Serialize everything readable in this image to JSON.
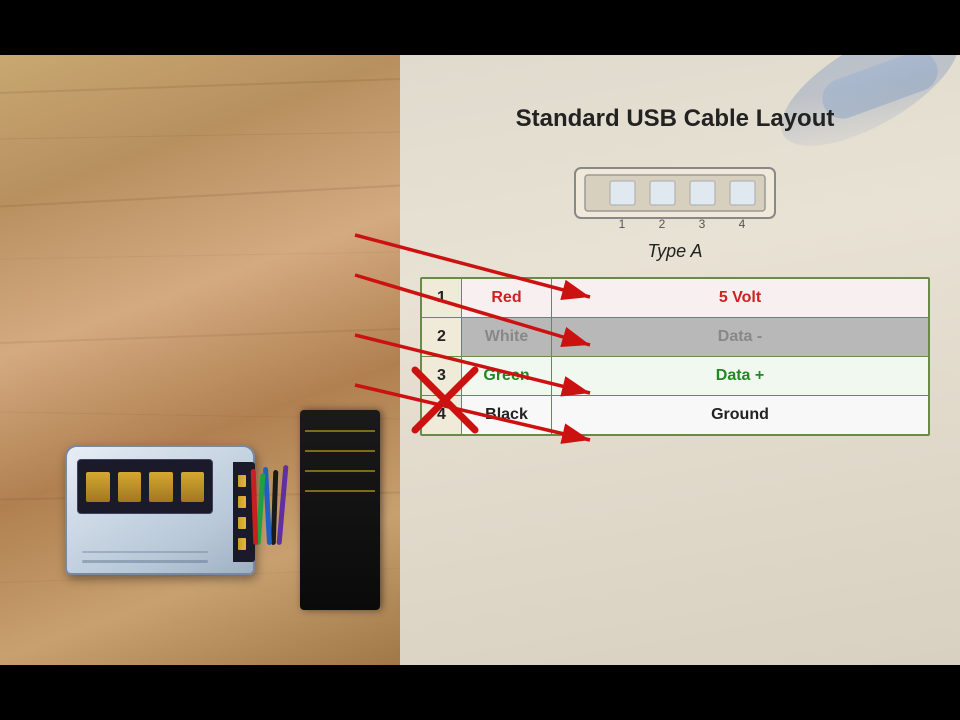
{
  "page": {
    "title": "Standard USB Cable Layout",
    "subtitle": "Type A",
    "bars": {
      "top": "",
      "bottom": ""
    }
  },
  "usb_diagram": {
    "pin_numbers_label": "1  2  3  4"
  },
  "pin_table": {
    "rows": [
      {
        "num": "1",
        "color": "Red",
        "function": "5 Volt"
      },
      {
        "num": "2",
        "color": "White",
        "function": "Data -"
      },
      {
        "num": "3",
        "color": "Green",
        "function": "Data +"
      },
      {
        "num": "4",
        "color": "Black",
        "function": "Ground"
      }
    ]
  }
}
